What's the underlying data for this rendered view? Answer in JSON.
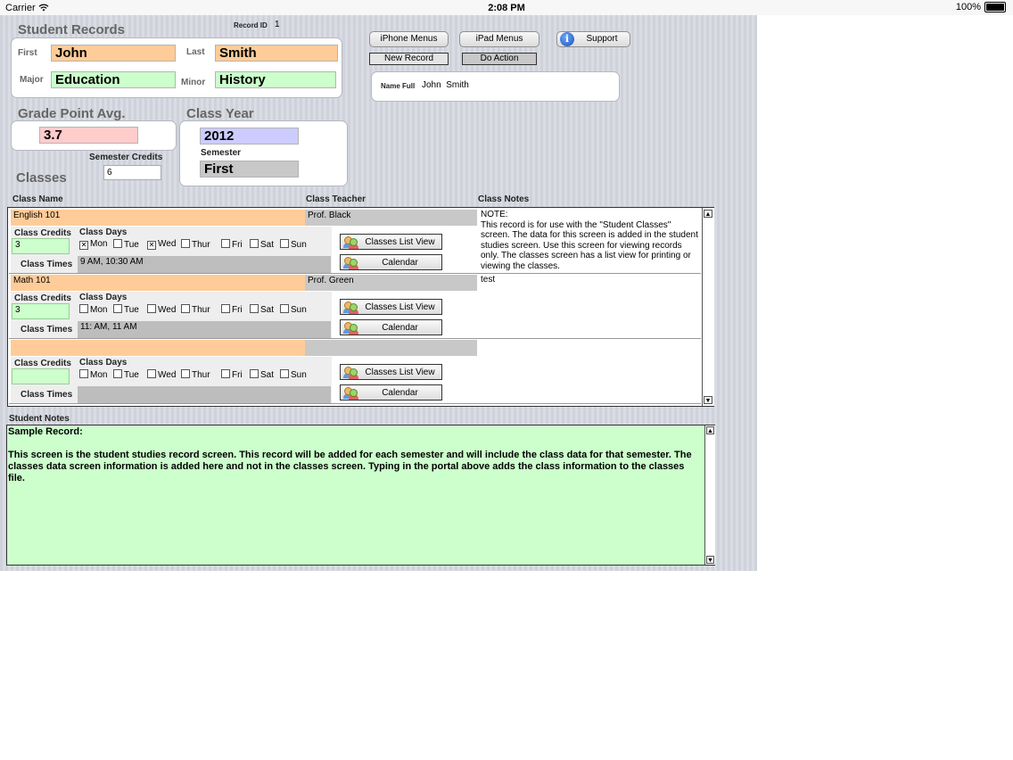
{
  "status_bar": {
    "carrier": "Carrier",
    "time": "2:08 PM",
    "battery": "100%"
  },
  "student": {
    "title": "Student Records",
    "record_id_label": "Record ID",
    "record_id": "1",
    "first_label": "First",
    "first": "John",
    "last_label": "Last",
    "last": "Smith",
    "major_label": "Major",
    "major": "Education",
    "minor_label": "Minor",
    "minor": "History"
  },
  "buttons": {
    "iphone_menus": "iPhone Menus",
    "ipad_menus": "iPad Menus",
    "support": "Support",
    "new_record": "New Record",
    "do_action": "Do Action"
  },
  "name_full": {
    "label": "Name Full",
    "value": "John  Smith"
  },
  "gpa": {
    "title": "Grade Point Avg.",
    "value": "3.7"
  },
  "class_year": {
    "title": "Class Year",
    "value": "2012",
    "semester_label": "Semester",
    "semester": "First"
  },
  "semester_credits": {
    "label": "Semester Credits",
    "value": "6"
  },
  "classes": {
    "title": "Classes",
    "col_name": "Class Name",
    "col_teacher": "Class Teacher",
    "col_notes": "Class Notes",
    "credits_label": "Class Credits",
    "days_label": "Class Days",
    "times_label": "Class Times",
    "list_view_label": "Classes List View",
    "calendar_label": "Calendar",
    "day_names": [
      "Mon",
      "Tue",
      "Wed",
      "Thur",
      "Fri",
      "Sat",
      "Sun"
    ],
    "rows": [
      {
        "name": "English 101",
        "teacher": "Prof. Black",
        "credits": "3",
        "times": "9 AM, 10:30 AM",
        "days": [
          true,
          false,
          true,
          false,
          false,
          false,
          false
        ],
        "notes": "NOTE:\nThis record is for use with the \"Student Classes\" screen. The data for this screen is added in the student studies screen. Use this screen for viewing records only. The classes screen has a list view for printing or viewing the classes."
      },
      {
        "name": "Math 101",
        "teacher": "Prof. Green",
        "credits": "3",
        "times": "11: AM, 11 AM",
        "days": [
          false,
          false,
          false,
          false,
          false,
          false,
          false
        ],
        "notes": "test"
      },
      {
        "name": "",
        "teacher": "",
        "credits": "",
        "times": "",
        "days": [
          false,
          false,
          false,
          false,
          false,
          false,
          false
        ],
        "notes": ""
      }
    ]
  },
  "student_notes": {
    "label": "Student Notes",
    "title": "Sample Record:",
    "body": "This screen is the student studies record screen. This record will be added for each semester and will include the class data for that semester. The classes data screen information is added here and not in the classes screen. Typing in the portal above adds the class information to the classes file."
  },
  "colors": {
    "orange": "#ffcc99",
    "green": "#ccffcc",
    "pink": "#ffcccc",
    "lavender": "#ccccff",
    "gray": "#c8c8c8"
  }
}
